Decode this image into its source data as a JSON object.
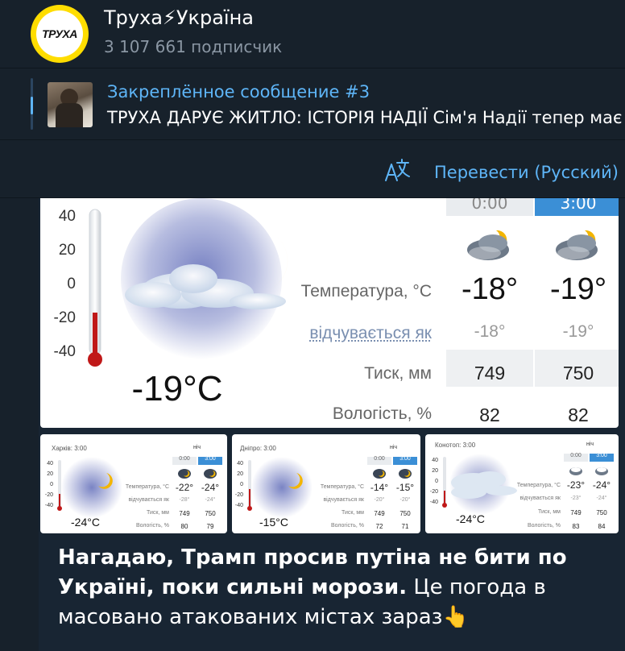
{
  "channel": {
    "avatar_text": "ТРУХА",
    "title": "Труха⚡Україна",
    "subscribers": "3 107 661 подписчик"
  },
  "pinned": {
    "title": "Закреплённое сообщение #3",
    "text": "ТРУХА ДАРУЄ ЖИТЛО: ІСТОРІЯ НАДІЇ  Сім'я Надії тепер має"
  },
  "translate": {
    "label": "Перевести (Русский)"
  },
  "weather_main": {
    "temp_now": "-19°C",
    "scale": [
      "40",
      "20",
      "0",
      "-20",
      "-40"
    ],
    "columns": [
      {
        "time": "0:00",
        "temp": "-18°",
        "feels": "-18°",
        "pressure": "749",
        "humidity": "82"
      },
      {
        "time": "3:00",
        "temp": "-19°",
        "feels": "-19°",
        "pressure": "750",
        "humidity": "82"
      }
    ],
    "labels": {
      "temp": "Температура, °С",
      "feels": "відчувається як",
      "pressure": "Тиск, мм",
      "humidity": "Вологість, %"
    }
  },
  "weather_thumbs": [
    {
      "city": "Харків: 3:00",
      "period": "ніч",
      "temp_now": "-24°C",
      "scale": [
        "40",
        "20",
        "0",
        "-20",
        "-40"
      ],
      "columns": [
        {
          "time": "0:00",
          "temp": "-22°",
          "feels": "-28°",
          "pressure": "749",
          "humidity": "80"
        },
        {
          "time": "3:00",
          "temp": "-24°",
          "feels": "-24°",
          "pressure": "750",
          "humidity": "79"
        }
      ],
      "labels": {
        "temp": "Температура, °С",
        "feels": "відчувається як",
        "pressure": "Тиск, мм",
        "humidity": "Вологість, %"
      }
    },
    {
      "city": "Дніпро: 3:00",
      "period": "ніч",
      "temp_now": "-15°C",
      "scale": [
        "40",
        "20",
        "0",
        "-20",
        "-40"
      ],
      "columns": [
        {
          "time": "0:00",
          "temp": "-14°",
          "feels": "-20°",
          "pressure": "749",
          "humidity": "72"
        },
        {
          "time": "3:00",
          "temp": "-15°",
          "feels": "-20°",
          "pressure": "750",
          "humidity": "71"
        }
      ],
      "labels": {
        "temp": "Температура, °С",
        "feels": "відчувається як",
        "pressure": "Тиск, мм",
        "humidity": "Вологість, %"
      }
    },
    {
      "city": "Конотоп: 3:00",
      "period": "ніч",
      "temp_now": "-24°C",
      "scale": [
        "40",
        "20",
        "0",
        "-20",
        "-40"
      ],
      "columns": [
        {
          "time": "0:00",
          "temp": "-23°",
          "feels": "-23°",
          "pressure": "749",
          "humidity": "83"
        },
        {
          "time": "3:00",
          "temp": "-24°",
          "feels": "-24°",
          "pressure": "750",
          "humidity": "84"
        }
      ],
      "labels": {
        "temp": "Температура, °С",
        "feels": "відчувається як",
        "pressure": "Тиск, мм",
        "humidity": "Вологість, %"
      }
    }
  ],
  "caption": {
    "bold": "Нагадаю, Трамп просив путіна не бити по Україні, поки сильні морози.",
    "rest": " Це погода в масовано атакованих містах зараз",
    "emoji": "👆"
  },
  "colors": {
    "accent": "#5eb5f7",
    "bg": "#17212b",
    "bubble": "#182533",
    "avatar_yellow": "#ffdd00",
    "weather_active_col": "#3b8fd6"
  }
}
